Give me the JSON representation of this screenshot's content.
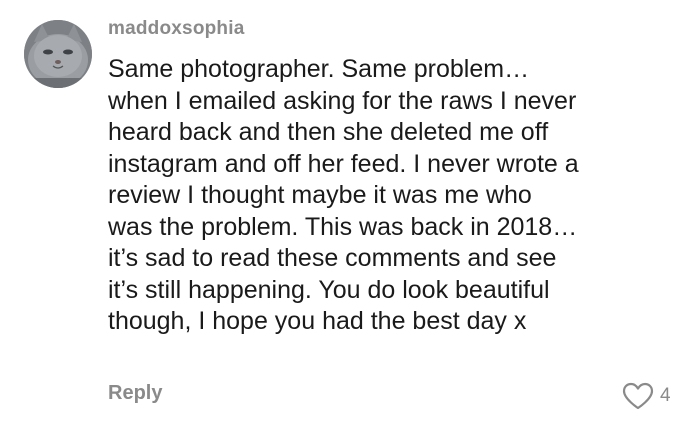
{
  "comment": {
    "username": "maddoxsophia",
    "lines": [
      "Same photographer. Same problem…",
      "when I emailed asking for the raws I never",
      "heard back and then she deleted me off",
      "instagram and off her feed. I never wrote a",
      "review I thought maybe it was me who",
      "was the problem. This was back in 2018…",
      "it’s sad to read these comments and see",
      "it’s still happening. You do look beautiful",
      "though, I hope you had the best day x"
    ],
    "reply_label": "Reply",
    "like_count": "4"
  },
  "colors": {
    "meta_text": "#8a8a8a",
    "body_text": "#1a1a1a",
    "background": "#ffffff"
  },
  "icons": {
    "like": "heart-outline-icon",
    "avatar": "grey-cat-photo"
  }
}
